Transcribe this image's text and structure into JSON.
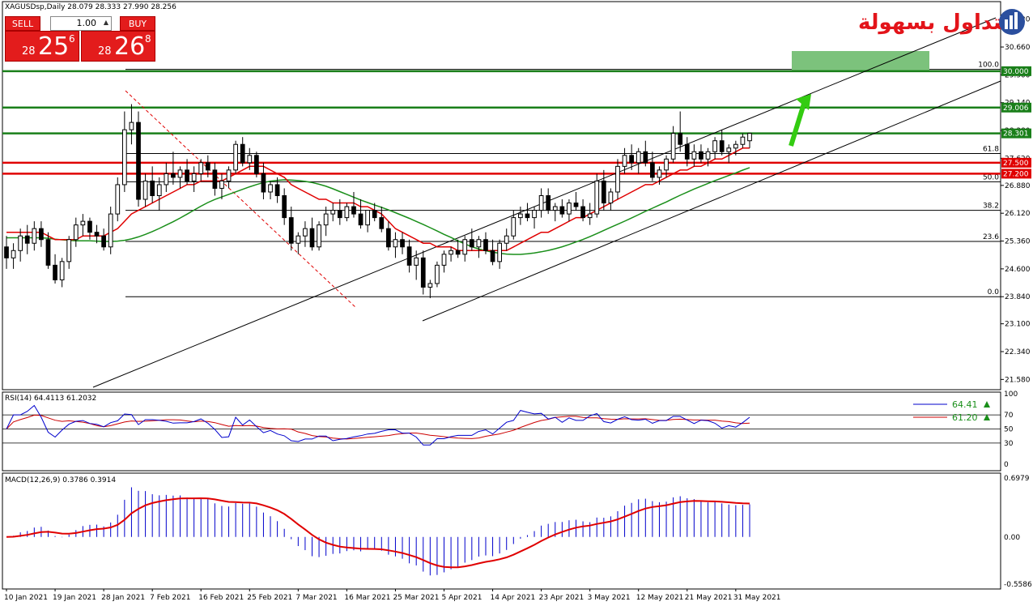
{
  "header": {
    "symbol_line": "XAGUSDsp,Daily  28.079 28.333 27.990 28.256"
  },
  "trade_panel": {
    "sell_label": "SELL",
    "buy_label": "BUY",
    "lot": "1.00",
    "sell_small": "28",
    "sell_big": "25",
    "sell_sup": "6",
    "buy_small": "28",
    "buy_big": "26",
    "buy_sup": "8"
  },
  "logo": {
    "text": "التداول بسهولة"
  },
  "colors": {
    "bull": "#ffffff",
    "bear": "#000000",
    "ma_fast": "#e00000",
    "ma_slow": "#1a8f1a",
    "support": "#e00000",
    "resistance": "#1a7f1a",
    "target": "#7cc27c",
    "arrow": "#33cc11",
    "rsi": "#0000cc",
    "rsi_signal": "#cc0000",
    "macd_hist": "#0000cc",
    "macd_signal": "#e00000"
  },
  "chart_data": [
    {
      "type": "candlestick",
      "price_axis": [
        "31.420",
        "30.660",
        "29.900",
        "29.140",
        "28.380",
        "27.620",
        "26.880",
        "26.120",
        "25.360",
        "24.600",
        "23.840",
        "23.100",
        "22.340",
        "21.580"
      ],
      "ylim": [
        21.3,
        31.9
      ],
      "date_labels": [
        "10 Jan 2021",
        "19 Jan 2021",
        "28 Jan 2021",
        "7 Feb 2021",
        "16 Feb 2021",
        "25 Feb 2021",
        "7 Mar 2021",
        "16 Mar 2021",
        "25 Mar 2021",
        "5 Apr 2021",
        "14 Apr 2021",
        "23 Apr 2021",
        "3 May 2021",
        "12 May 2021",
        "21 May 2021",
        "31 May 2021"
      ],
      "date_index": [
        0,
        7,
        14,
        21,
        28,
        35,
        42,
        49,
        56,
        63,
        70,
        77,
        84,
        91,
        98,
        105
      ],
      "ohlc": [
        [
          25.2,
          25.5,
          24.6,
          24.9
        ],
        [
          24.9,
          25.3,
          24.6,
          25.1
        ],
        [
          25.1,
          25.7,
          24.8,
          25.5
        ],
        [
          25.5,
          25.8,
          25.0,
          25.3
        ],
        [
          25.3,
          25.9,
          25.1,
          25.7
        ],
        [
          25.7,
          25.9,
          25.2,
          25.4
        ],
        [
          25.4,
          25.6,
          24.6,
          24.7
        ],
        [
          24.7,
          25.0,
          24.2,
          24.3
        ],
        [
          24.3,
          24.9,
          24.1,
          24.8
        ],
        [
          24.8,
          25.5,
          24.6,
          25.4
        ],
        [
          25.4,
          26.0,
          25.2,
          25.8
        ],
        [
          25.8,
          26.1,
          25.5,
          25.9
        ],
        [
          25.9,
          26.0,
          25.4,
          25.6
        ],
        [
          25.6,
          25.8,
          25.3,
          25.5
        ],
        [
          25.5,
          25.7,
          25.1,
          25.2
        ],
        [
          25.2,
          26.3,
          25.0,
          26.1
        ],
        [
          26.1,
          27.1,
          25.9,
          26.9
        ],
        [
          26.9,
          28.9,
          26.7,
          28.4
        ],
        [
          28.4,
          29.1,
          28.0,
          28.6
        ],
        [
          28.6,
          28.9,
          26.3,
          26.5
        ],
        [
          26.5,
          27.2,
          26.3,
          27.0
        ],
        [
          27.0,
          27.4,
          26.4,
          26.6
        ],
        [
          26.6,
          27.1,
          26.2,
          26.9
        ],
        [
          26.9,
          27.5,
          26.7,
          27.2
        ],
        [
          27.2,
          27.8,
          26.9,
          27.1
        ],
        [
          27.1,
          27.4,
          26.8,
          27.3
        ],
        [
          27.3,
          27.6,
          26.9,
          27.0
        ],
        [
          27.0,
          27.4,
          26.7,
          27.2
        ],
        [
          27.2,
          27.6,
          27.0,
          27.5
        ],
        [
          27.5,
          27.7,
          27.1,
          27.3
        ],
        [
          27.3,
          27.5,
          26.6,
          26.8
        ],
        [
          26.8,
          27.2,
          26.5,
          27.0
        ],
        [
          27.0,
          27.4,
          26.8,
          27.3
        ],
        [
          27.3,
          28.1,
          27.2,
          28.0
        ],
        [
          28.0,
          28.2,
          27.4,
          27.5
        ],
        [
          27.5,
          27.9,
          27.3,
          27.7
        ],
        [
          27.7,
          27.8,
          27.1,
          27.2
        ],
        [
          27.2,
          27.5,
          26.5,
          26.7
        ],
        [
          26.7,
          27.0,
          26.5,
          26.9
        ],
        [
          26.9,
          27.1,
          26.4,
          26.6
        ],
        [
          26.6,
          26.8,
          25.8,
          26.0
        ],
        [
          26.0,
          26.3,
          25.1,
          25.3
        ],
        [
          25.3,
          25.6,
          25.0,
          25.5
        ],
        [
          25.5,
          25.9,
          25.2,
          25.7
        ],
        [
          25.7,
          26.0,
          25.1,
          25.2
        ],
        [
          25.2,
          25.9,
          25.1,
          25.8
        ],
        [
          25.8,
          26.3,
          25.5,
          26.1
        ],
        [
          26.1,
          26.4,
          25.9,
          26.2
        ],
        [
          26.2,
          26.5,
          25.8,
          26.0
        ],
        [
          26.0,
          26.4,
          25.9,
          26.3
        ],
        [
          26.3,
          26.7,
          26.0,
          26.1
        ],
        [
          26.1,
          26.5,
          25.7,
          25.8
        ],
        [
          25.8,
          26.2,
          25.6,
          26.2
        ],
        [
          26.2,
          26.4,
          25.9,
          26.0
        ],
        [
          26.0,
          26.3,
          25.6,
          25.7
        ],
        [
          25.7,
          25.9,
          25.1,
          25.2
        ],
        [
          25.2,
          25.6,
          24.9,
          25.4
        ],
        [
          25.4,
          25.6,
          25.0,
          25.2
        ],
        [
          25.2,
          25.4,
          24.5,
          24.7
        ],
        [
          24.7,
          25.1,
          24.3,
          24.9
        ],
        [
          24.9,
          25.1,
          23.9,
          24.1
        ],
        [
          24.1,
          24.3,
          23.8,
          24.2
        ],
        [
          24.2,
          24.8,
          24.1,
          24.7
        ],
        [
          24.7,
          25.1,
          24.5,
          25.0
        ],
        [
          25.0,
          25.2,
          24.8,
          25.1
        ],
        [
          25.1,
          25.4,
          24.9,
          25.0
        ],
        [
          25.0,
          25.5,
          24.8,
          25.4
        ],
        [
          25.4,
          25.7,
          25.1,
          25.2
        ],
        [
          25.2,
          25.5,
          24.9,
          25.4
        ],
        [
          25.4,
          25.6,
          25.0,
          25.1
        ],
        [
          25.1,
          25.4,
          24.7,
          24.8
        ],
        [
          24.8,
          25.4,
          24.6,
          25.3
        ],
        [
          25.3,
          25.7,
          25.1,
          25.5
        ],
        [
          25.5,
          26.2,
          25.4,
          26.0
        ],
        [
          26.0,
          26.3,
          25.8,
          26.1
        ],
        [
          26.1,
          26.4,
          25.9,
          26.0
        ],
        [
          26.0,
          26.3,
          25.7,
          26.2
        ],
        [
          26.2,
          26.8,
          26.0,
          26.6
        ],
        [
          26.6,
          26.8,
          26.1,
          26.2
        ],
        [
          26.2,
          26.4,
          25.9,
          26.3
        ],
        [
          26.3,
          26.5,
          26.0,
          26.1
        ],
        [
          26.1,
          26.5,
          25.9,
          26.4
        ],
        [
          26.4,
          26.7,
          26.2,
          26.3
        ],
        [
          26.3,
          26.5,
          25.9,
          26.0
        ],
        [
          26.0,
          26.4,
          25.8,
          26.1
        ],
        [
          26.1,
          27.2,
          26.0,
          27.0
        ],
        [
          27.0,
          27.3,
          26.2,
          26.4
        ],
        [
          26.4,
          26.8,
          26.2,
          26.7
        ],
        [
          26.7,
          27.6,
          26.5,
          27.4
        ],
        [
          27.4,
          27.9,
          27.2,
          27.7
        ],
        [
          27.7,
          28.0,
          27.3,
          27.5
        ],
        [
          27.5,
          27.9,
          27.2,
          27.8
        ],
        [
          27.8,
          28.1,
          27.4,
          27.5
        ],
        [
          27.5,
          27.8,
          27.0,
          27.1
        ],
        [
          27.1,
          27.4,
          26.9,
          27.3
        ],
        [
          27.3,
          27.7,
          27.1,
          27.6
        ],
        [
          27.6,
          28.5,
          27.5,
          28.3
        ],
        [
          28.3,
          28.9,
          27.8,
          28.0
        ],
        [
          28.0,
          28.2,
          27.4,
          27.6
        ],
        [
          27.6,
          28.0,
          27.4,
          27.8
        ],
        [
          27.8,
          28.0,
          27.5,
          27.6
        ],
        [
          27.6,
          27.9,
          27.4,
          27.8
        ],
        [
          27.8,
          28.2,
          27.6,
          28.1
        ],
        [
          28.1,
          28.4,
          27.7,
          27.8
        ],
        [
          27.8,
          28.0,
          27.5,
          27.9
        ],
        [
          27.9,
          28.1,
          27.7,
          28.0
        ],
        [
          28.0,
          28.3,
          27.9,
          28.2
        ],
        [
          28.1,
          28.3,
          27.9,
          28.3
        ]
      ],
      "ma_fast": [
        25.6,
        25.6,
        25.6,
        25.6,
        25.6,
        25.6,
        25.5,
        25.4,
        25.4,
        25.4,
        25.4,
        25.5,
        25.5,
        25.5,
        25.5,
        25.6,
        25.7,
        25.9,
        26.1,
        26.2,
        26.3,
        26.4,
        26.5,
        26.6,
        26.7,
        26.8,
        26.9,
        26.9,
        27.0,
        27.0,
        27.0,
        27.0,
        27.1,
        27.2,
        27.3,
        27.4,
        27.4,
        27.4,
        27.3,
        27.2,
        27.1,
        26.9,
        26.8,
        26.7,
        26.6,
        26.5,
        26.5,
        26.4,
        26.4,
        26.4,
        26.4,
        26.3,
        26.3,
        26.2,
        26.1,
        25.9,
        25.7,
        25.6,
        25.5,
        25.4,
        25.3,
        25.3,
        25.2,
        25.2,
        25.2,
        25.1,
        25.1,
        25.1,
        25.1,
        25.1,
        25.1,
        25.1,
        25.1,
        25.2,
        25.3,
        25.4,
        25.5,
        25.6,
        25.6,
        25.7,
        25.8,
        25.9,
        26.0,
        26.0,
        26.1,
        26.2,
        26.3,
        26.4,
        26.5,
        26.6,
        26.7,
        26.8,
        26.9,
        26.9,
        27.0,
        27.1,
        27.2,
        27.3,
        27.3,
        27.4,
        27.4,
        27.5,
        27.6,
        27.6,
        27.7,
        27.8,
        27.9,
        27.9
      ],
      "ma_slow": [
        null,
        null,
        null,
        null,
        null,
        null,
        null,
        null,
        null,
        null,
        null,
        null,
        null,
        null,
        null,
        null,
        null,
        null,
        null,
        null,
        null,
        null,
        null,
        null,
        null,
        null,
        null,
        null,
        null,
        null,
        null,
        null,
        null,
        null,
        null,
        null,
        null,
        null,
        null,
        null,
        null,
        null,
        null,
        null,
        null,
        null,
        null,
        null,
        null,
        null,
        null,
        null,
        null,
        null,
        null,
        null,
        null,
        null,
        null,
        null,
        null,
        null,
        null,
        null,
        null,
        null,
        null,
        null,
        null,
        null,
        null,
        null,
        null,
        null,
        null,
        null,
        null,
        null,
        null,
        null,
        null,
        null,
        null,
        null,
        null,
        null,
        null,
        null,
        null,
        null,
        null,
        null,
        null,
        null,
        null,
        null,
        null,
        null,
        null,
        null,
        null,
        null,
        null,
        null,
        null,
        null,
        null,
        null
      ],
      "hlines": [
        {
          "value": 30.0,
          "label": "30.000",
          "kind": "resistance"
        },
        {
          "value": 29.006,
          "label": "29.006",
          "kind": "resistance"
        },
        {
          "value": 28.301,
          "label": "28.301",
          "kind": "resistance"
        },
        {
          "value": 27.5,
          "label": "27.500",
          "kind": "support"
        },
        {
          "value": 27.2,
          "label": "27.200",
          "kind": "support"
        }
      ],
      "fib": [
        {
          "level": "100.0",
          "value": 30.05
        },
        {
          "level": "61.8",
          "value": 27.75
        },
        {
          "level": "50.0",
          "value": 26.98
        },
        {
          "level": "38.2",
          "value": 26.2
        },
        {
          "level": "23.6",
          "value": 25.35
        },
        {
          "level": "0.0",
          "value": 23.84
        }
      ]
    },
    {
      "type": "line",
      "title": "RSI(14) 64.4113 61.2032",
      "axis": [
        "100",
        "70",
        "50",
        "30",
        "0"
      ],
      "levels": [
        70,
        50,
        30
      ],
      "ylim": [
        0,
        100
      ],
      "series": [
        {
          "name": "64.41",
          "kind": "rsi"
        },
        {
          "name": "61.20",
          "kind": "signal"
        }
      ]
    },
    {
      "type": "bar",
      "title": "MACD(12,26,9) 0.3786 0.3914",
      "axis": [
        "0.6979",
        "0.00",
        "-0.5586"
      ],
      "ylim": [
        -0.5586,
        0.6979
      ]
    }
  ]
}
